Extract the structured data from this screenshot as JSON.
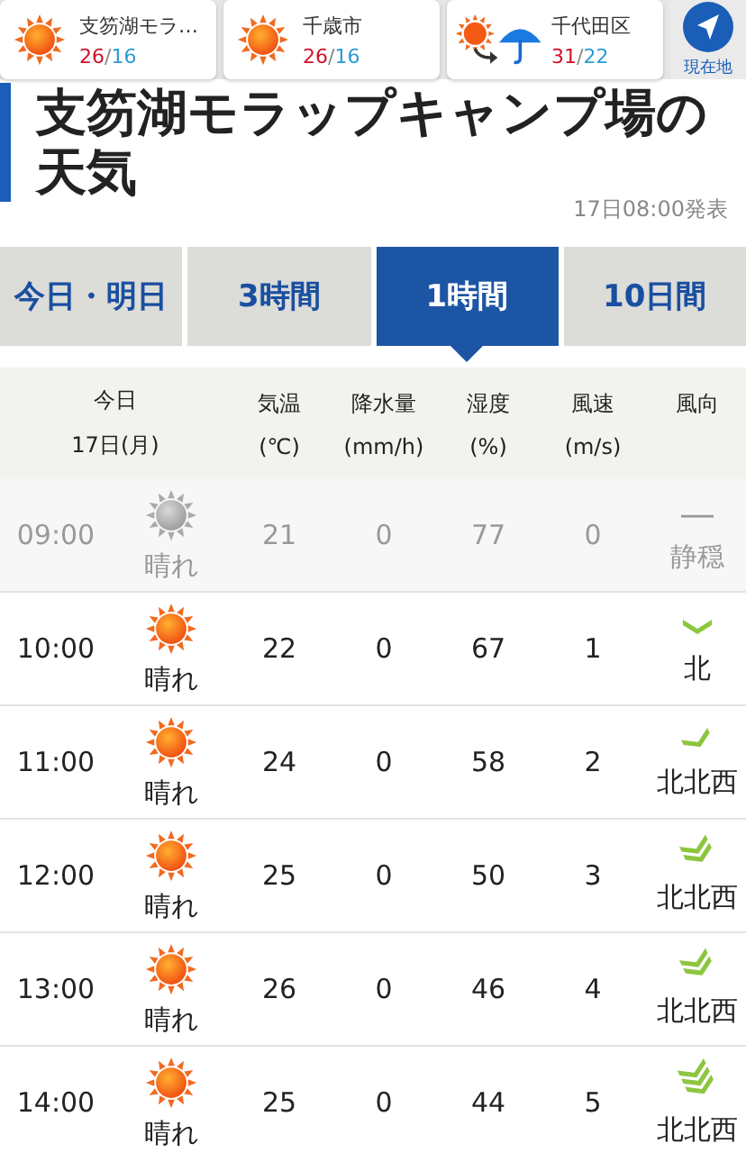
{
  "locations": [
    {
      "kind": "sun",
      "name": "支笏湖モラ…",
      "high": "26",
      "separator": "/",
      "low": "16"
    },
    {
      "kind": "sun",
      "name": "千歳市",
      "high": "26",
      "separator": "/",
      "low": "16"
    },
    {
      "kind": "sun-to-rain",
      "name": "千代田区",
      "high": "31",
      "separator": "/",
      "low": "22"
    }
  ],
  "current_location": {
    "label": "現在地"
  },
  "title": "支笏湖モラップキャンプ場の天気",
  "issued": "17日08:00発表",
  "tabs": [
    {
      "label": "今日・明日",
      "selected": false
    },
    {
      "label": "3時間",
      "selected": false
    },
    {
      "label": "1時間",
      "selected": true
    },
    {
      "label": "10日間",
      "selected": false
    }
  ],
  "columns": [
    {
      "line1": "今日",
      "line2": "17日(月)"
    },
    {
      "line1": "気温",
      "line2": "(℃)"
    },
    {
      "line1": "降水量",
      "line2": "(mm/h)"
    },
    {
      "line1": "湿度",
      "line2": "(%)"
    },
    {
      "line1": "風速",
      "line2": "(m/s)"
    },
    {
      "line1": "風向"
    }
  ],
  "rows": [
    {
      "time": "09:00",
      "past": true,
      "kind": "sun",
      "weather": "晴れ",
      "temp": "21",
      "rain": "0",
      "humidity": "77",
      "wind": "0",
      "wind_icon": {
        "kind": "calm",
        "mark": "—"
      },
      "direction": "静穏"
    },
    {
      "time": "10:00",
      "past": false,
      "kind": "sun",
      "weather": "晴れ",
      "temp": "22",
      "rain": "0",
      "humidity": "67",
      "wind": "1",
      "wind_icon": {
        "kind": "n1"
      },
      "direction": "北"
    },
    {
      "time": "11:00",
      "past": false,
      "kind": "sun",
      "weather": "晴れ",
      "temp": "24",
      "rain": "0",
      "humidity": "58",
      "wind": "2",
      "wind_icon": {
        "kind": "nnw1"
      },
      "direction": "北北西"
    },
    {
      "time": "12:00",
      "past": false,
      "kind": "sun",
      "weather": "晴れ",
      "temp": "25",
      "rain": "0",
      "humidity": "50",
      "wind": "3",
      "wind_icon": {
        "kind": "nnw2"
      },
      "direction": "北北西"
    },
    {
      "time": "13:00",
      "past": false,
      "kind": "sun",
      "weather": "晴れ",
      "temp": "26",
      "rain": "0",
      "humidity": "46",
      "wind": "4",
      "wind_icon": {
        "kind": "nnw2"
      },
      "direction": "北北西"
    },
    {
      "time": "14:00",
      "past": false,
      "kind": "sun",
      "weather": "晴れ",
      "temp": "25",
      "rain": "0",
      "humidity": "44",
      "wind": "5",
      "wind_icon": {
        "kind": "nnw3"
      },
      "direction": "北北西"
    }
  ]
}
